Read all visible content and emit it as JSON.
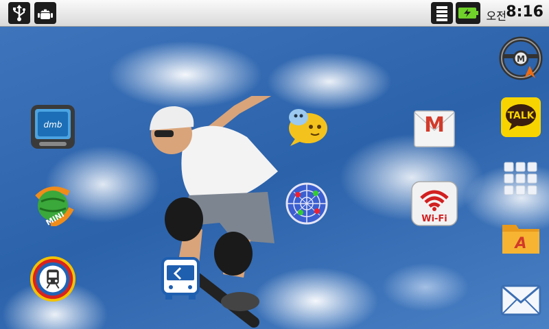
{
  "status_bar": {
    "ampm": "오전",
    "time": "8:16",
    "left_icons": [
      "usb-icon",
      "android-debug-icon"
    ],
    "right_icons": [
      "wifi-icon",
      "battery-charging-icon"
    ]
  },
  "home": {
    "apps": [
      {
        "name": "dmb-tv-app",
        "icon": "dmb-tv-icon"
      },
      {
        "name": "mini-app",
        "icon": "mini-globe-icon",
        "label": "MINI"
      },
      {
        "name": "subway-app",
        "icon": "subway-icon"
      },
      {
        "name": "bus-app",
        "icon": "bus-icon"
      },
      {
        "name": "chat-bubble-app",
        "icon": "chat-bubble-icon"
      },
      {
        "name": "radar-app",
        "icon": "radar-icon"
      },
      {
        "name": "gmail-app",
        "icon": "gmail-icon",
        "label": "M"
      },
      {
        "name": "wifi-app",
        "icon": "wifi-app-icon",
        "label": "Wi-Fi"
      },
      {
        "name": "navigation-app",
        "icon": "steering-wheel-icon",
        "label": "M"
      },
      {
        "name": "kakaotalk-app",
        "icon": "kakaotalk-icon",
        "label": "TALK"
      },
      {
        "name": "app-drawer",
        "icon": "app-drawer-grid-icon"
      },
      {
        "name": "file-manager-app",
        "icon": "folder-icon",
        "label": "A"
      },
      {
        "name": "email-app",
        "icon": "envelope-icon"
      }
    ]
  },
  "colors": {
    "sky": "#2b62aa",
    "gmail_red": "#d23a2a",
    "kakao_yellow": "#f7d400",
    "wifi_red": "#d22020"
  }
}
